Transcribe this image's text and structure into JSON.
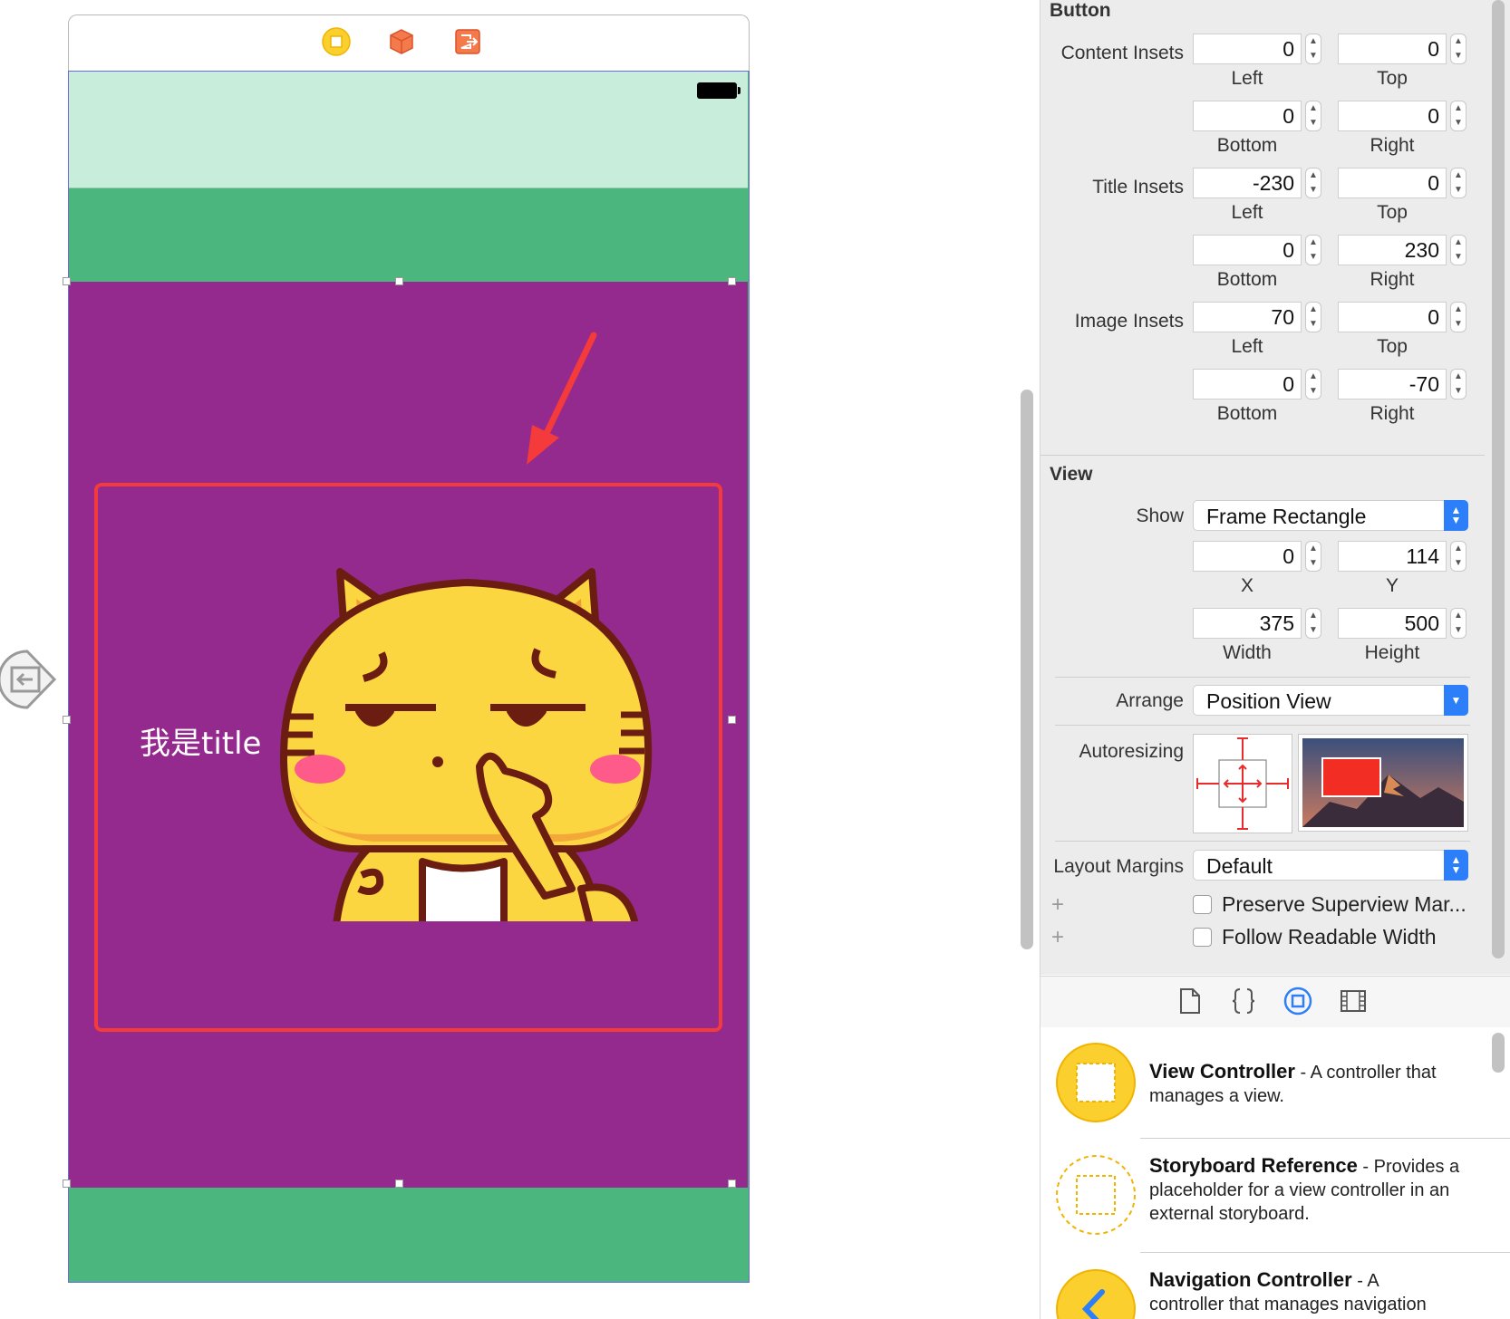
{
  "canvas": {
    "title_label": "我是title",
    "scene_icons": [
      "view-controller-icon",
      "first-responder-icon",
      "exit-icon"
    ]
  },
  "inspector": {
    "button_section": {
      "title": "Button",
      "content_insets_label": "Content Insets",
      "title_insets_label": "Title Insets",
      "image_insets_label": "Image Insets",
      "content_insets": {
        "left": "0",
        "top": "0",
        "bottom": "0",
        "right": "0"
      },
      "title_insets": {
        "left": "-230",
        "top": "0",
        "bottom": "0",
        "right": "230"
      },
      "image_insets": {
        "left": "70",
        "top": "0",
        "bottom": "0",
        "right": "-70"
      },
      "sub_labels": {
        "left": "Left",
        "top": "Top",
        "bottom": "Bottom",
        "right": "Right"
      }
    },
    "view_section": {
      "title": "View",
      "show_label": "Show",
      "show_value": "Frame Rectangle",
      "x": "0",
      "y": "114",
      "width": "375",
      "height": "500",
      "x_label": "X",
      "y_label": "Y",
      "width_label": "Width",
      "height_label": "Height",
      "arrange_label": "Arrange",
      "arrange_value": "Position View",
      "autoresizing_label": "Autoresizing",
      "layout_margins_label": "Layout Margins",
      "layout_margins_value": "Default",
      "preserve_superview": "Preserve Superview Mar...",
      "follow_readable": "Follow Readable Width"
    }
  },
  "library": {
    "tabs": [
      "file-template-icon",
      "code-snippet-icon",
      "object-library-icon",
      "media-library-icon"
    ],
    "items": [
      {
        "title": "View Controller",
        "desc_line1": " - A controller that",
        "desc_line2": "manages a view."
      },
      {
        "title": "Storyboard Reference",
        "desc_line1": " - Provides a",
        "desc_line2": "placeholder for a view controller in an",
        "desc_line3": "external storyboard."
      },
      {
        "title": "Navigation Controller",
        "desc_line1": " - A",
        "desc_line2": "controller that manages navigation"
      }
    ]
  },
  "colors": {
    "status_bar": "#c8eedb",
    "nav_green": "#4bb77f",
    "purple_button": "#94298e",
    "highlight_red": "#f43a3a",
    "accent_blue": "#2d7ff9",
    "cat_yellow": "#fbd640"
  }
}
